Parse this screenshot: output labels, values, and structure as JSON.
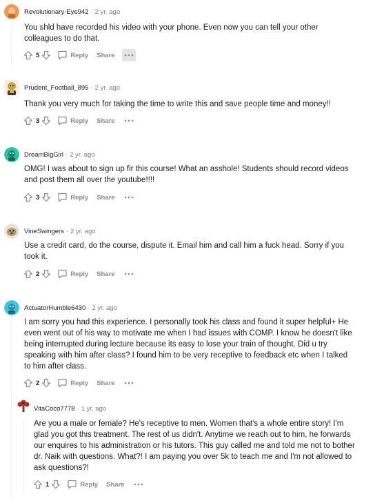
{
  "comments": [
    {
      "username": "Revolutionary-Eye942",
      "age": "2 yr. ago",
      "body": "You shld have recorded his video with your phone. Even now you can tell your other colleagues to do that.",
      "votes": "5",
      "reply": "Reply",
      "share": "Share",
      "avatar_color": "#e89a5a"
    },
    {
      "username": "Prudent_Football_895",
      "age": "2 yr. ago",
      "body": "Thank you very much for taking the time to write this and save people time and money!!",
      "votes": "3",
      "reply": "Reply",
      "share": "Share",
      "avatar_color": "#c9a24a"
    },
    {
      "username": "DreamBigGirl",
      "age": "2 yr. ago",
      "body": "OMG! I was about to sign up fir this course! What an asshole! Students should record videos and post them all over the youtube!!!!",
      "votes": "3",
      "reply": "Reply",
      "share": "Share",
      "avatar_color": "#26c6a6"
    },
    {
      "username": "VineSwingers",
      "age": "2 yr. ago",
      "body": "Use a credit card, do the course, dispute it. Email him and call him a fuck head. Sorry if you took it.",
      "votes": "2",
      "reply": "Reply",
      "share": "Share",
      "avatar_color": "#b99a74"
    },
    {
      "username": "ActuatorHumble6430",
      "age": "2 yr. ago",
      "body": "I am sorry you had this experience. I personally took his class and found it super helpful+ He even went out of his way to motivate me when I had issues with COMP. I know he doesn't like being interrupted during lecture because its easy to lose your train of thought. Did u try speaking with him after class? I found him to be very receptive to feedback etc when I talked to him after class.",
      "votes": "2",
      "reply": "Reply",
      "share": "Share",
      "avatar_color": "#3ec4e0"
    },
    {
      "username": "VitaCoco7778",
      "age": "1 yr. ago",
      "body": "Are you a male or female? He's receptive to men. Women that's a whole entire story! I'm glad you got this treatment. The rest of us didn't. Anytime we reach out to him, he forwards our enquires to his administration or his tutors. This guy called me and told me not to bother dr. Naik with questions. What?! I am paying you over 5k to teach me and I'm not allowed to ask questions?!",
      "votes": "1",
      "reply": "Reply",
      "share": "Share",
      "avatar_color": "#c0392b"
    }
  ]
}
